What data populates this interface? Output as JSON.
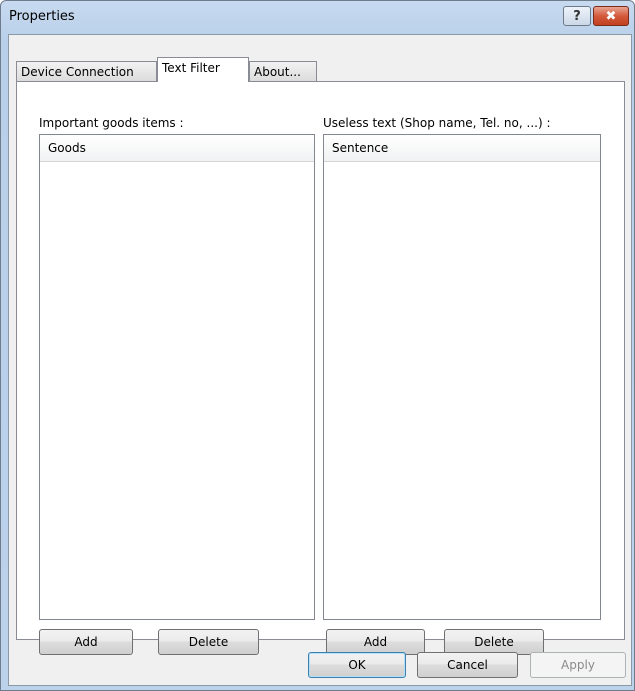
{
  "window": {
    "title": "Properties"
  },
  "caption_buttons": {
    "help": "?",
    "close": "✖"
  },
  "tabs": [
    {
      "label": "Device Connection",
      "active": false
    },
    {
      "label": "Text Filter",
      "active": true
    },
    {
      "label": "About...",
      "active": false
    }
  ],
  "left_group": {
    "label": "Important goods items :",
    "column_header": "Goods",
    "add_label": "Add",
    "delete_label": "Delete"
  },
  "right_group": {
    "label": "Useless text (Shop name, Tel. no, ...) :",
    "column_header": "Sentence",
    "add_label": "Add",
    "delete_label": "Delete"
  },
  "footer": {
    "ok_label": "OK",
    "cancel_label": "Cancel",
    "apply_label": "Apply"
  }
}
